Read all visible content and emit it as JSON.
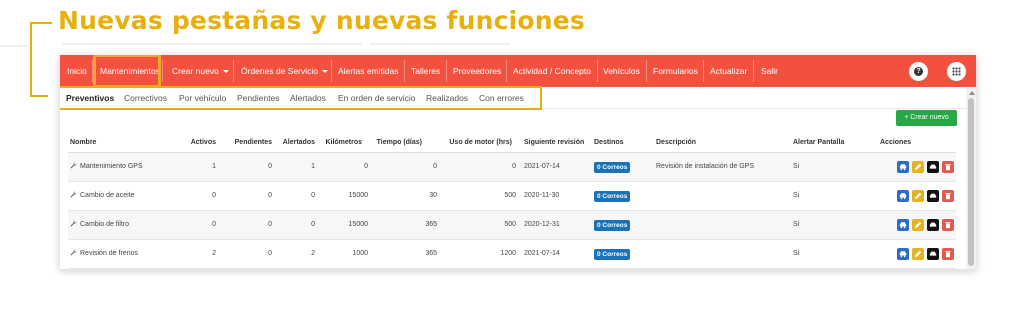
{
  "headline": "Nuevas pestañas y nuevas funciones",
  "colors": {
    "accent": "#e8b00c",
    "navbar": "#f2513f",
    "create": "#28a745",
    "badge": "#1a73b8"
  },
  "nav": {
    "items": [
      {
        "label": "Inicio"
      },
      {
        "label": "Mantenimientos"
      },
      {
        "label": "Crear nuevo",
        "dropdown": true
      },
      {
        "label": "Órdenes de Servicio",
        "dropdown": true
      },
      {
        "label": "Alertas emitidas"
      },
      {
        "label": "Talleres"
      },
      {
        "label": "Proveedores"
      },
      {
        "label": "Actividad / Concepto"
      },
      {
        "label": "Vehículos"
      },
      {
        "label": "Formularios"
      },
      {
        "label": "Actualizar"
      },
      {
        "label": "Salir"
      }
    ],
    "help_icon": "question-circle-icon",
    "apps_icon": "grid-icon"
  },
  "subtabs": [
    "Preventivos",
    "Correctivos",
    "Por vehículo",
    "Pendientes",
    "Alertados",
    "En orden de servicio",
    "Realizados",
    "Con errores"
  ],
  "create_button": "Crear nuevo",
  "table": {
    "headers": [
      "Nombre",
      "Activos",
      "Pendientes",
      "Alertados",
      "Kilómetros",
      "Tiempo (días)",
      "Uso de motor (hrs)",
      "Siguiente revisión",
      "Destinos",
      "Descripción",
      "Alertar Pantalla",
      "Acciones"
    ],
    "rows": [
      {
        "name": "Mantenimiento GPS",
        "activos": "1",
        "pendientes": "0",
        "alertados": "1",
        "km": "0",
        "tiempo": "0",
        "motor": "0",
        "siguiente": "2021-07-14",
        "destinos": "0 Correos",
        "descripcion": "Revisión de instalación de GPS",
        "alertar": "Si"
      },
      {
        "name": "Cambio de aceite",
        "activos": "0",
        "pendientes": "0",
        "alertados": "0",
        "km": "15000",
        "tiempo": "30",
        "motor": "500",
        "siguiente": "2020-11-30",
        "destinos": "0 Correos",
        "descripcion": "",
        "alertar": "Si"
      },
      {
        "name": "Cambio de filtro",
        "activos": "0",
        "pendientes": "0",
        "alertados": "0",
        "km": "15000",
        "tiempo": "365",
        "motor": "500",
        "siguiente": "2020-12-31",
        "destinos": "0 Correos",
        "descripcion": "",
        "alertar": "Si"
      },
      {
        "name": "Revisión de frenos",
        "activos": "2",
        "pendientes": "0",
        "alertados": "2",
        "km": "1000",
        "tiempo": "365",
        "motor": "1200",
        "siguiente": "2021-07-14",
        "destinos": "0 Correos",
        "descripcion": "",
        "alertar": "Si"
      }
    ]
  }
}
